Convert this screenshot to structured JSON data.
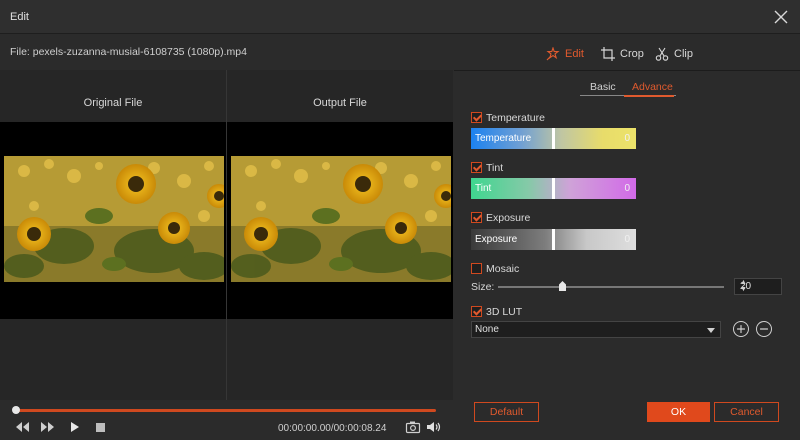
{
  "window": {
    "title": "Edit"
  },
  "file": {
    "label": "File:  pexels-zuzanna-musial-6108735 (1080p).mp4"
  },
  "preview": {
    "original_label": "Original File",
    "output_label": "Output File"
  },
  "playback": {
    "timecode": "00:00:00.00/00:00:08.24",
    "progress": 0.0
  },
  "top_tabs": [
    {
      "label": "Edit",
      "icon": "magic-wand-icon",
      "active": true
    },
    {
      "label": "Crop",
      "icon": "crop-icon",
      "active": false
    },
    {
      "label": "Clip",
      "icon": "scissors-icon",
      "active": false
    }
  ],
  "sub_tabs": {
    "basic": "Basic",
    "advance": "Advance",
    "active": "advance"
  },
  "adjustments": {
    "temperature": {
      "label": "Temperature",
      "checked": true,
      "bar_label": "Temperature",
      "value": "0"
    },
    "tint": {
      "label": "Tint",
      "checked": true,
      "bar_label": "Tint",
      "value": "0"
    },
    "exposure": {
      "label": "Exposure",
      "checked": true,
      "bar_label": "Exposure",
      "value": "0"
    }
  },
  "mosaic": {
    "label": "Mosaic",
    "checked": false,
    "size_label": "Size:",
    "size_value": "20"
  },
  "lut": {
    "label": "3D LUT",
    "checked": true,
    "selected": "None"
  },
  "buttons": {
    "default": "Default",
    "ok": "OK",
    "cancel": "Cancel"
  },
  "colors": {
    "accent": "#e0491c",
    "panel": "#2b2b2b",
    "viewer_bg": "#000000"
  }
}
